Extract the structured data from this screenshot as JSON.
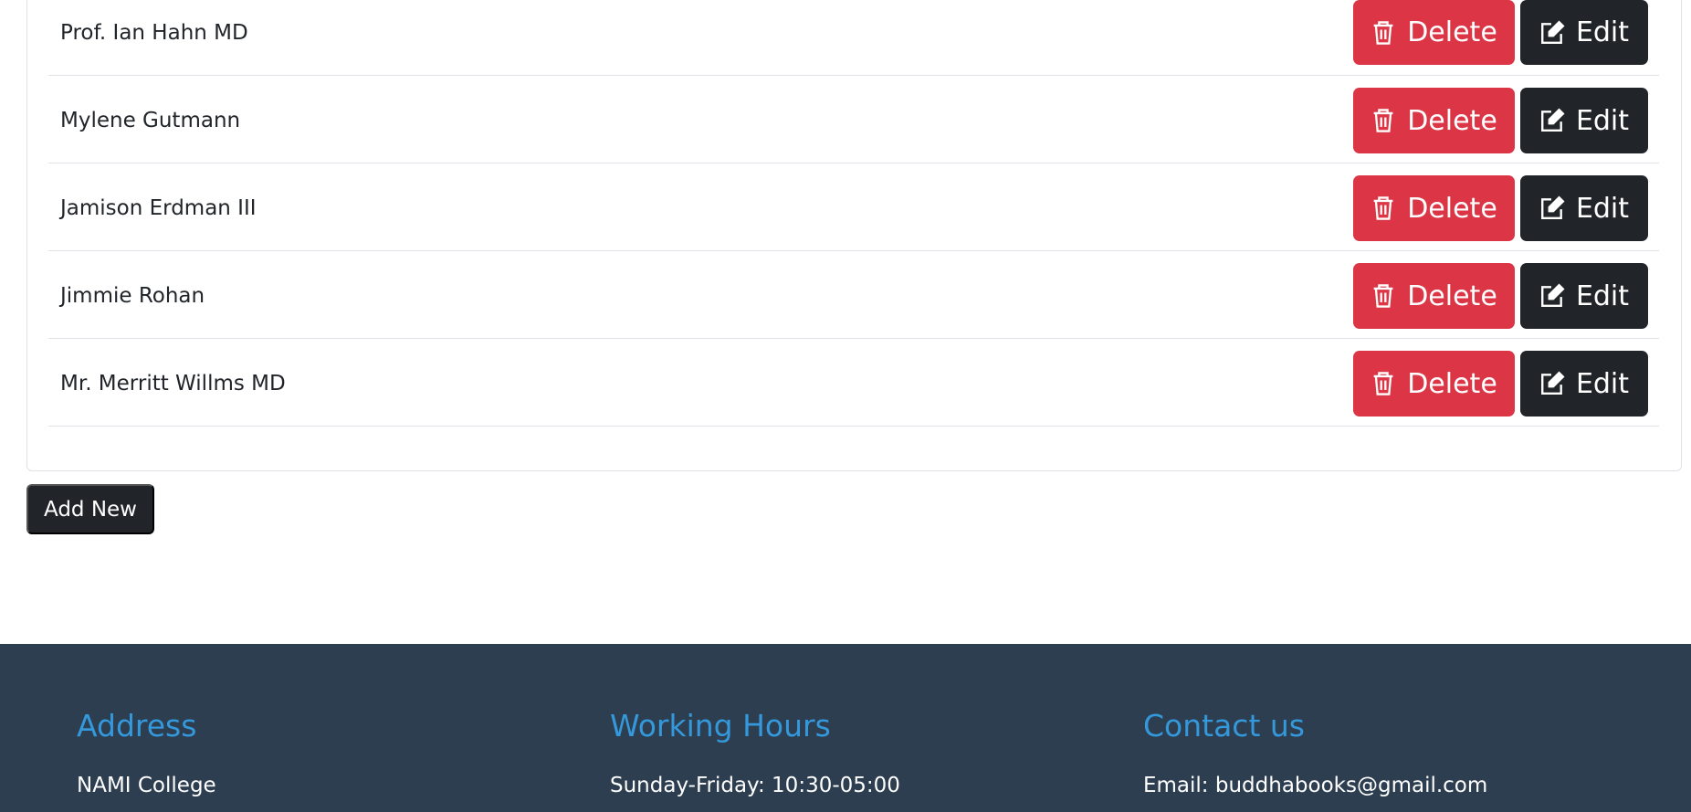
{
  "entries": [
    {
      "name": "Prof. Ian Hahn MD"
    },
    {
      "name": "Mylene Gutmann"
    },
    {
      "name": "Jamison Erdman III"
    },
    {
      "name": "Jimmie Rohan"
    },
    {
      "name": "Mr. Merritt Willms MD"
    }
  ],
  "actions": {
    "delete_label": "Delete",
    "edit_label": "Edit",
    "delete_icon": "trash-icon",
    "edit_icon": "pencil-square-icon",
    "delete_color": "#dc3545",
    "edit_color": "#212529"
  },
  "add_new_label": "Add New",
  "footer": {
    "background": "#2c3e50",
    "heading_color": "#3498db",
    "address": {
      "heading": "Address",
      "line1": "NAMI College"
    },
    "hours": {
      "heading": "Working Hours",
      "line1": "Sunday-Friday: 10:30-05:00"
    },
    "contact": {
      "heading": "Contact us",
      "line1": "Email: buddhabooks@gmail.com"
    }
  }
}
